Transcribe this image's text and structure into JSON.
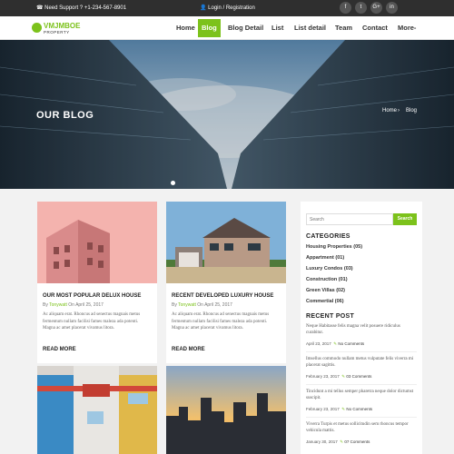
{
  "topbar": {
    "support": "Need Support ? +1-234-567-8901",
    "login": "Login / Registration",
    "social": [
      "f",
      "t",
      "G+",
      "in"
    ]
  },
  "logo": {
    "name": "VMJMBOE",
    "sub": "PROPERTY"
  },
  "nav": {
    "items": [
      {
        "label": "Home"
      },
      {
        "label": "Blog"
      },
      {
        "label": "Blog Detail"
      },
      {
        "label": "List"
      },
      {
        "label": "List detail"
      },
      {
        "label": "Team"
      },
      {
        "label": "Contact"
      },
      {
        "label": "More-"
      }
    ]
  },
  "hero": {
    "title": "OUR BLOG",
    "crumb_home": "Home",
    "crumb_current": "Blog"
  },
  "posts": [
    {
      "title": "OUR MOST POPULAR DELUX HOUSE",
      "by": "By",
      "author": "Tonywatt",
      "date": "On April 25, 2017",
      "excerpt": "Ac aliquam erat. Rhoncus ad senectus magnais metus fermentum nullam facilisi fames maleza ada potenti. Magna ac amet placerat vivamus litora.",
      "more": "READ MORE"
    },
    {
      "title": "RECENT DEVELOPED LUXURY HOUSE",
      "by": "By",
      "author": "Tonywatt",
      "date": "On April 25, 2017",
      "excerpt": "Ac aliquam erat. Rhoncus ad senectus magnais metus fermentum nullam facilisi fames maleza ada potenti. Magna ac amet placerat vivamus litora.",
      "more": "READ MORE"
    }
  ],
  "sidebar": {
    "search_placeholder": "Search",
    "search_button": "Search",
    "categories_title": "CATEGORIES",
    "categories": [
      "Housing Properties (05)",
      "Appartment (01)",
      "Luxury Condos (03)",
      "Construction (01)",
      "Green Villas (02)",
      "Commertial (06)"
    ],
    "recent_title": "RECENT POST",
    "recent": [
      {
        "title": "Neque Habitasse felis magna velit posuere ridiculus curabitur.",
        "date": "April 23, 2017",
        "comments": "No Comments"
      },
      {
        "title": "Imsellus commodo nullam metus vulputate felis viverra mi placerat sagittis.",
        "date": "February 23, 2017",
        "comments": "03 Comments"
      },
      {
        "title": "Tincidunt a mi tellus semper pharetra neque dolor dictumst suscipit.",
        "date": "February 23, 2017",
        "comments": "No Comments"
      },
      {
        "title": "Viverra Turpis et metus sollicitudin sem rhoncus tempor vehicula mattis.",
        "date": "January 30, 2017",
        "comments": "07 Comments"
      }
    ]
  },
  "colors": {
    "accent": "#7cc21b",
    "topbar": "#2f2f2f"
  }
}
